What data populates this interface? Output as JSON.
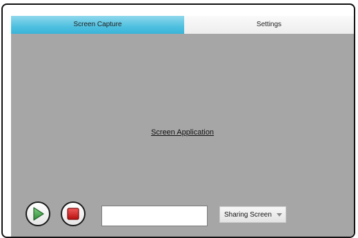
{
  "tabs": [
    {
      "label": "Screen Capture",
      "active": true
    },
    {
      "label": "Settings",
      "active": false
    }
  ],
  "main": {
    "center_label": "Screen Application"
  },
  "controls": {
    "play_icon": "play-icon",
    "stop_icon": "stop-icon",
    "input_value": "",
    "input_placeholder": "",
    "dropdown_selected": "Sharing Screen"
  },
  "colors": {
    "tab_active": "#4fc0e0",
    "content_background": "#a6a6a6",
    "play_green": "#3fa34d",
    "stop_red": "#d42020"
  }
}
